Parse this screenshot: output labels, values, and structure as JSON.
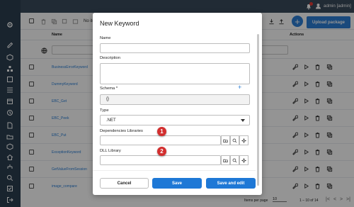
{
  "topbar": {
    "username": "admin [admin]"
  },
  "toolbar": {
    "items_selected": "No items s",
    "upload_label": "Upload package",
    "add_label": "+"
  },
  "table": {
    "col_name": "Name",
    "col_actions": "Actions",
    "rows": [
      {
        "name": "BusinessErrorKeyword"
      },
      {
        "name": "DummyKeyword"
      },
      {
        "name": "EBC_Get"
      },
      {
        "name": "EBC_Peek"
      },
      {
        "name": "EBC_Put"
      },
      {
        "name": "ExceptionKeyword"
      },
      {
        "name": "GetValueFromSession"
      },
      {
        "name": "image_compare"
      }
    ]
  },
  "footer": {
    "items_per_page_label": "Items per page",
    "items_per_page_value": "10",
    "range_label": "1 – 10 of 14"
  },
  "modal": {
    "title": "New Keyword",
    "name_label": "Name",
    "name_value": "",
    "description_label": "Description",
    "description_value": "",
    "schema_label": "Schema",
    "schema_required": "*",
    "schema_value": "{}",
    "type_label": "Type",
    "type_value": ".NET",
    "dependencies_label": "Dependencies Libraries",
    "dll_label": "DLL Library",
    "badge_1": "1",
    "badge_2": "2",
    "cancel_label": "Cancel",
    "save_label": "Save",
    "save_edit_label": "Save and edit"
  }
}
